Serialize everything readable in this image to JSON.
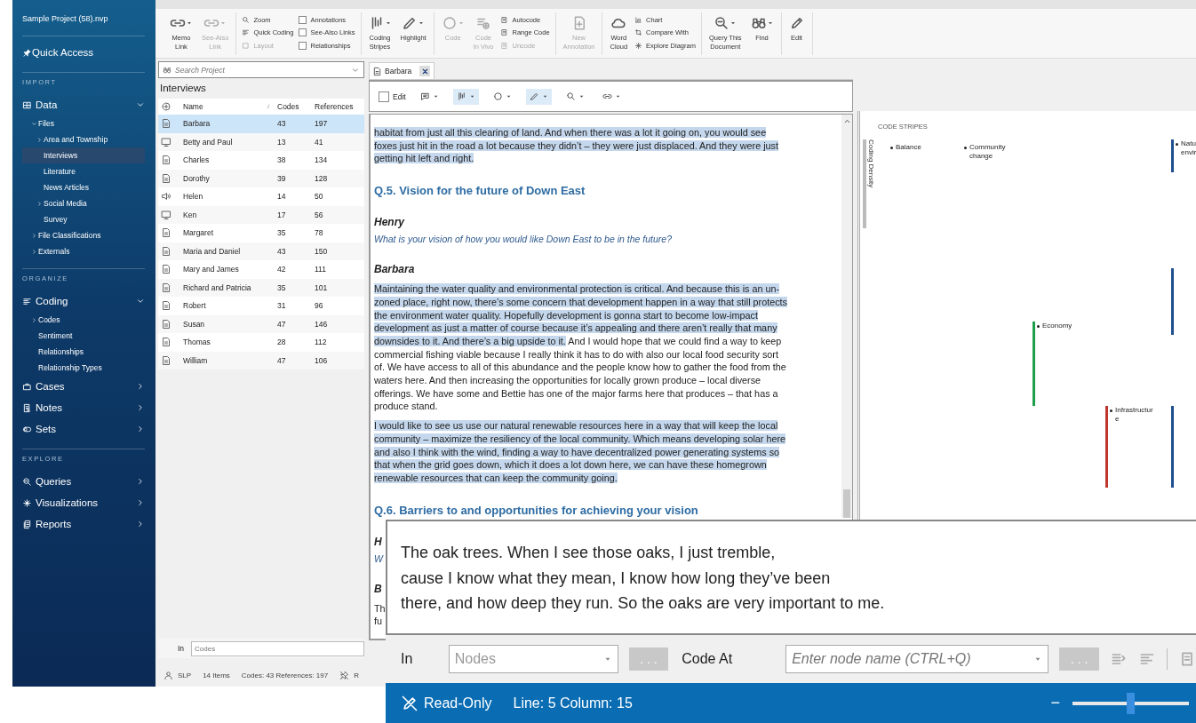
{
  "sidebar": {
    "project": "Sample Project (58).nvp",
    "quick_access": "Quick Access",
    "sections": [
      {
        "title": "IMPORT",
        "items": [
          {
            "label": "Data",
            "expanded": true,
            "selected": false,
            "children": [
              {
                "label": "Files",
                "expanded": true,
                "selected": false,
                "children": [
                  {
                    "label": "Area and Township",
                    "expanded": false,
                    "selected": false
                  },
                  {
                    "label": "Interviews",
                    "selected": true
                  },
                  {
                    "label": "Literature",
                    "selected": false
                  },
                  {
                    "label": "News Articles",
                    "selected": false
                  },
                  {
                    "label": "Social Media",
                    "expanded": false,
                    "selected": false
                  },
                  {
                    "label": "Survey",
                    "selected": false
                  }
                ]
              },
              {
                "label": "File Classifications",
                "expanded": false,
                "selected": false
              },
              {
                "label": "Externals",
                "expanded": false,
                "selected": false
              }
            ]
          }
        ]
      },
      {
        "title": "ORGANIZE",
        "items": [
          {
            "label": "Coding",
            "expanded": true,
            "selected": false,
            "children": [
              {
                "label": "Codes",
                "expanded": false,
                "selected": false
              },
              {
                "label": "Sentiment",
                "selected": false
              },
              {
                "label": "Relationships",
                "selected": false
              },
              {
                "label": "Relationship Types",
                "selected": false
              }
            ]
          },
          {
            "label": "Cases",
            "expanded": false,
            "selected": false
          },
          {
            "label": "Notes",
            "expanded": false,
            "selected": false
          },
          {
            "label": "Sets",
            "expanded": false,
            "selected": false
          }
        ]
      },
      {
        "title": "EXPLORE",
        "items": [
          {
            "label": "Queries",
            "expanded": false,
            "selected": false
          },
          {
            "label": "Visualizations",
            "expanded": false,
            "selected": false
          },
          {
            "label": "Reports",
            "expanded": false,
            "selected": false
          }
        ]
      }
    ]
  },
  "ribbon": {
    "groups": [
      {
        "items": [
          {
            "kind": "large",
            "lines": [
              "Memo",
              "Link"
            ],
            "disabled": false
          },
          {
            "kind": "large",
            "lines": [
              "See-Also",
              "Link"
            ],
            "disabled": true
          }
        ]
      },
      {
        "items": [
          {
            "kind": "small",
            "label": "Zoom",
            "disabled": false
          },
          {
            "kind": "small",
            "label": "Quick Coding",
            "disabled": false
          },
          {
            "kind": "small",
            "label": "Layout",
            "disabled": true
          },
          {
            "kind": "check",
            "label": "Annotations",
            "checked": false
          },
          {
            "kind": "check",
            "label": "See-Also Links",
            "checked": false
          },
          {
            "kind": "check",
            "label": "Relationships",
            "checked": false
          }
        ]
      },
      {
        "items": [
          {
            "kind": "large",
            "lines": [
              "Coding",
              "Stripes"
            ],
            "disabled": false
          },
          {
            "kind": "large",
            "lines": [
              "Highlight"
            ],
            "disabled": false
          }
        ]
      },
      {
        "items": [
          {
            "kind": "large",
            "lines": [
              "Code"
            ],
            "disabled": true
          },
          {
            "kind": "large",
            "lines": [
              "Code",
              "In Vivo"
            ],
            "disabled": true
          },
          {
            "kind": "small",
            "label": "Autocode",
            "disabled": false
          },
          {
            "kind": "small",
            "label": "Range Code",
            "disabled": false
          },
          {
            "kind": "small",
            "label": "Uncode",
            "disabled": true
          }
        ]
      },
      {
        "items": [
          {
            "kind": "large",
            "lines": [
              "New",
              "Annotation"
            ],
            "disabled": true
          }
        ]
      },
      {
        "items": [
          {
            "kind": "large",
            "lines": [
              "Word",
              "Cloud"
            ],
            "disabled": false
          },
          {
            "kind": "small",
            "label": "Chart",
            "disabled": false
          },
          {
            "kind": "small",
            "label": "Compare With",
            "disabled": false
          },
          {
            "kind": "small",
            "label": "Explore Diagram",
            "disabled": false
          }
        ]
      },
      {
        "items": [
          {
            "kind": "large",
            "lines": [
              "Query This",
              "Document"
            ],
            "disabled": false
          },
          {
            "kind": "large",
            "lines": [
              "Find"
            ],
            "disabled": false
          }
        ]
      },
      {
        "items": [
          {
            "kind": "large",
            "lines": [
              "Edit"
            ],
            "disabled": false
          }
        ]
      }
    ]
  },
  "list": {
    "search_placeholder": "Search Project",
    "title": "Interviews",
    "columns": [
      "Name",
      "Codes",
      "References"
    ],
    "rows": [
      {
        "kind": "document",
        "name": "Barbara",
        "codes": "43",
        "references": "197",
        "selected": true
      },
      {
        "kind": "video",
        "name": "Betty and Paul",
        "codes": "13",
        "references": "41",
        "selected": false
      },
      {
        "kind": "document",
        "name": "Charles",
        "codes": "38",
        "references": "134",
        "selected": false
      },
      {
        "kind": "document",
        "name": "Dorothy",
        "codes": "39",
        "references": "128",
        "selected": false
      },
      {
        "kind": "audio",
        "name": "Helen",
        "codes": "14",
        "references": "50",
        "selected": false
      },
      {
        "kind": "video",
        "name": "Ken",
        "codes": "17",
        "references": "56",
        "selected": false
      },
      {
        "kind": "document",
        "name": "Margaret",
        "codes": "35",
        "references": "78",
        "selected": false
      },
      {
        "kind": "document",
        "name": "Maria and Daniel",
        "codes": "43",
        "references": "150",
        "selected": false
      },
      {
        "kind": "document",
        "name": "Mary and James",
        "codes": "42",
        "references": "111",
        "selected": false
      },
      {
        "kind": "document",
        "name": "Richard and Patricia",
        "codes": "35",
        "references": "101",
        "selected": false
      },
      {
        "kind": "document",
        "name": "Robert",
        "codes": "31",
        "references": "96",
        "selected": false
      },
      {
        "kind": "document",
        "name": "Susan",
        "codes": "47",
        "references": "146",
        "selected": false
      },
      {
        "kind": "document",
        "name": "Thomas",
        "codes": "28",
        "references": "112",
        "selected": false
      },
      {
        "kind": "document",
        "name": "William",
        "codes": "47",
        "references": "106",
        "selected": false
      }
    ],
    "filter": {
      "label": "In",
      "placeholder": "Codes"
    },
    "status": {
      "user": "SLP",
      "items": "14 Items",
      "summary": "Codes: 43  References: 197",
      "cut": "R"
    }
  },
  "document": {
    "tab": "Barbara",
    "edit": {
      "label": "Edit",
      "checked": false
    },
    "buttons": [
      {
        "on": false
      },
      {
        "on": true
      },
      {
        "on": false
      },
      {
        "on": true
      },
      {
        "on": false
      },
      {
        "on": false
      }
    ],
    "content": [
      {
        "kind": "paragraph",
        "segments": [
          {
            "text": "habitat from just all this clearing of land. And when there was a lot it going on, you would see foxes just hit in the road a lot because they didn’t – they were just displaced. And they were just getting hit left and right.",
            "highlighted": true
          }
        ]
      },
      {
        "kind": "heading",
        "text": "Q.5. Vision for the future of Down East"
      },
      {
        "kind": "speaker",
        "text": "Henry"
      },
      {
        "kind": "question",
        "text": "What is your vision of how you would like Down East to be in the future?"
      },
      {
        "kind": "speaker",
        "text": "Barbara"
      },
      {
        "kind": "paragraph",
        "segments": [
          {
            "text": "Maintaining the water quality and environmental protection is critical. And because this is an un-zoned place, right now, there’s some concern that development happen in a way that still protects the environment water quality. Hopefully development is gonna start to become low-impact development as just a matter of course because it’s appealing and there aren’t really that many downsides to it. And there’s a big upside to it.",
            "highlighted": true
          },
          {
            "text": " And I would hope that we could find a way to keep commercial fishing viable because I really think it has to do with also our local food security sort of. We have access to all of this abundance and the people know how to gather the food from the waters here. And then increasing the opportunities for locally grown produce – local diverse offerings. We have some and Bettie has one of the major farms here that produces – that has a produce stand.",
            "highlighted": false
          }
        ]
      },
      {
        "kind": "paragraph",
        "segments": [
          {
            "text": "I would like to see us use our natural renewable resources here in a way that will keep the local community – maximize the resiliency of the local community. Which means developing solar here and also I think with the wind, finding a way to have decentralized power generating systems so that when the grid goes down, which it does a lot down here, we can have these homegrown renewable resources that can keep the community going.",
            "highlighted": true
          }
        ]
      },
      {
        "kind": "heading",
        "text": "Q.6. Barriers to and opportunities for achieving your vision"
      },
      {
        "kind": "speaker",
        "text": "H"
      },
      {
        "kind": "question",
        "text": "W"
      },
      {
        "kind": "speaker",
        "text": "B"
      },
      {
        "kind": "paragraph",
        "segments": [
          {
            "text": "Th",
            "highlighted": false
          }
        ]
      },
      {
        "kind": "line",
        "segments": [
          {
            "text": "fu",
            "highlighted": false
          }
        ]
      }
    ]
  },
  "code_stripes": {
    "title": "CODE STRIPES",
    "axis_label": "Coding Density",
    "codes": [
      {
        "label": "Balance"
      },
      {
        "label": "Community change"
      },
      {
        "label": "Natu envir",
        "color": "#1f4f8f"
      },
      {
        "label": "Economy",
        "color": "#1e9e4a"
      },
      {
        "label": "Infrastructur e",
        "color": "#c0362c"
      }
    ]
  },
  "zoom_view": {
    "lines": [
      "The oak trees. When I see those oaks, I just tremble,",
      "cause I know what they mean, I know how long they’ve been",
      "there, and how deep they run. So the oaks are very important to me."
    ]
  },
  "coding_bar": {
    "in_label": "In",
    "nodes": "Nodes",
    "browse": ". . .",
    "code_at": "Code At",
    "node_placeholder": "Enter node name (CTRL+Q)",
    "browse_nodes": ". . ."
  },
  "status_bar": {
    "mode": "Read-Only",
    "position": "Line: 5 Column: 15",
    "zoom_out": "−",
    "zoom": {
      "level": 0.5
    }
  }
}
